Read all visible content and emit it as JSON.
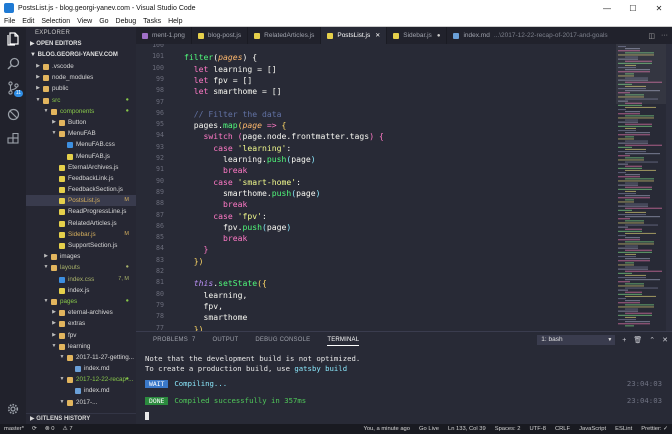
{
  "window": {
    "title": "PostsList.js - blog.georgi-yanev.com - Visual Studio Code",
    "buttons": {
      "minimize": "—",
      "maximize": "☐",
      "close": "✕"
    }
  },
  "menu": [
    "File",
    "Edit",
    "Selection",
    "View",
    "Go",
    "Debug",
    "Tasks",
    "Help"
  ],
  "activity_bar": {
    "scm_badge": "11",
    "icons": [
      "files-icon",
      "search-icon",
      "source-control-icon",
      "debug-icon",
      "extensions-icon",
      "settings-gear-icon"
    ]
  },
  "sidebar": {
    "header": "EXPLORER",
    "open_editors": "OPEN EDITORS",
    "project": "BLOG.GEORGI-YANEV.COM",
    "footer": "GITLENS HISTORY",
    "tree": [
      {
        "label": ".vscode",
        "depth": 0,
        "kind": "folder",
        "arrow": "▶"
      },
      {
        "label": "node_modules",
        "depth": 0,
        "kind": "folder",
        "arrow": "▶"
      },
      {
        "label": "public",
        "depth": 0,
        "kind": "folder",
        "arrow": "▶"
      },
      {
        "label": "src",
        "depth": 0,
        "kind": "folder",
        "arrow": "▼",
        "color": "green",
        "dot": true
      },
      {
        "label": "components",
        "depth": 1,
        "kind": "folder",
        "arrow": "▼",
        "color": "green",
        "dot": true
      },
      {
        "label": "Button",
        "depth": 2,
        "kind": "folder",
        "arrow": "▶"
      },
      {
        "label": "MenuFAB",
        "depth": 2,
        "kind": "folder",
        "arrow": "▼"
      },
      {
        "label": "MenuFAB.css",
        "depth": 3,
        "kind": "css"
      },
      {
        "label": "MenuFAB.js",
        "depth": 3,
        "kind": "js"
      },
      {
        "label": "EternalArchives.js",
        "depth": 2,
        "kind": "js"
      },
      {
        "label": "FeedbackLink.js",
        "depth": 2,
        "kind": "js"
      },
      {
        "label": "FeedbackSection.js",
        "depth": 2,
        "kind": "js"
      },
      {
        "label": "PostsList.js",
        "depth": 2,
        "kind": "js",
        "color": "gold",
        "decoration": "M",
        "selected": true
      },
      {
        "label": "ReadProgressLine.js",
        "depth": 2,
        "kind": "js"
      },
      {
        "label": "RelatedArticles.js",
        "depth": 2,
        "kind": "js"
      },
      {
        "label": "Sidebar.js",
        "depth": 2,
        "kind": "js",
        "color": "gold",
        "decoration": "M"
      },
      {
        "label": "SupportSection.js",
        "depth": 2,
        "kind": "js"
      },
      {
        "label": "images",
        "depth": 1,
        "kind": "folder",
        "arrow": "▶"
      },
      {
        "label": "layouts",
        "depth": 1,
        "kind": "folder",
        "arrow": "▼",
        "color": "olive",
        "dot": true
      },
      {
        "label": "index.css",
        "depth": 2,
        "kind": "css",
        "color": "olive",
        "decoration": "7, M"
      },
      {
        "label": "index.js",
        "depth": 2,
        "kind": "js"
      },
      {
        "label": "pages",
        "depth": 1,
        "kind": "folder",
        "arrow": "▼",
        "color": "green",
        "dot": true
      },
      {
        "label": "eternal-archives",
        "depth": 2,
        "kind": "folder",
        "arrow": "▶"
      },
      {
        "label": "extras",
        "depth": 2,
        "kind": "folder",
        "arrow": "▶"
      },
      {
        "label": "fpv",
        "depth": 2,
        "kind": "folder",
        "arrow": "▶"
      },
      {
        "label": "learning",
        "depth": 2,
        "kind": "folder",
        "arrow": "▼"
      },
      {
        "label": "2017-11-27-getting...",
        "depth": 3,
        "kind": "folder",
        "arrow": "▼"
      },
      {
        "label": "index.md",
        "depth": 4,
        "kind": "md"
      },
      {
        "label": "2017-12-22-recap-...",
        "depth": 3,
        "kind": "folder",
        "arrow": "▼",
        "color": "green",
        "dot": true
      },
      {
        "label": "index.md",
        "depth": 4,
        "kind": "md"
      },
      {
        "label": "2017-...",
        "depth": 3,
        "kind": "folder",
        "arrow": "▼"
      }
    ]
  },
  "tabs": [
    {
      "label": "ment-1.png",
      "icon": "image",
      "dot": false
    },
    {
      "label": "blog-post.js",
      "icon": "js",
      "dot": false
    },
    {
      "label": "RelatedArticles.js",
      "icon": "js",
      "dot": false
    },
    {
      "label": "PostsList.js",
      "icon": "js",
      "active": true,
      "close": "✕"
    },
    {
      "label": "Sidebar.js",
      "icon": "js",
      "dot": true
    },
    {
      "label": "index.md",
      "icon": "md",
      "dot": false,
      "suffix": "...\\2017-12-22-recap-of-2017-and-goals"
    }
  ],
  "editor": {
    "line_numbers": [
      "100",
      "101",
      "100",
      "99",
      "98",
      "97",
      "96",
      "95",
      "94",
      "93",
      "92",
      "91",
      "90",
      "89",
      "88",
      "87",
      "86",
      "85",
      "84",
      "83",
      "82",
      "81",
      "80",
      "79",
      "78",
      "77"
    ],
    "lines": [
      [
        {
          "t": "",
          "c": "pu"
        }
      ],
      [
        {
          "t": "filter",
          "c": "fn"
        },
        {
          "t": "(",
          "c": "pu"
        },
        {
          "t": "pages",
          "c": "par"
        },
        {
          "t": ") {",
          "c": "pu"
        }
      ],
      [
        {
          "t": "  let ",
          "c": "kw"
        },
        {
          "t": "learning",
          "c": "var"
        },
        {
          "t": " = []",
          "c": "pu"
        }
      ],
      [
        {
          "t": "  let ",
          "c": "kw"
        },
        {
          "t": "fpv",
          "c": "var"
        },
        {
          "t": " = []",
          "c": "pu"
        }
      ],
      [
        {
          "t": "  let ",
          "c": "kw"
        },
        {
          "t": "smarthome",
          "c": "var"
        },
        {
          "t": " = []",
          "c": "pu"
        }
      ],
      [
        {
          "t": "",
          "c": "pu"
        }
      ],
      [
        {
          "t": "  // Filter the data",
          "c": "cm"
        }
      ],
      [
        {
          "t": "  pages",
          "c": "var"
        },
        {
          "t": ".",
          "c": "pu"
        },
        {
          "t": "map",
          "c": "fn"
        },
        {
          "t": "(",
          "c": "b1"
        },
        {
          "t": "page",
          "c": "par"
        },
        {
          "t": " => ",
          "c": "kw"
        },
        {
          "t": "{",
          "c": "b1"
        }
      ],
      [
        {
          "t": "    switch ",
          "c": "kw"
        },
        {
          "t": "(",
          "c": "b2"
        },
        {
          "t": "page.node.frontmatter.tags",
          "c": "var"
        },
        {
          "t": ") ",
          "c": "b2"
        },
        {
          "t": "{",
          "c": "b2"
        }
      ],
      [
        {
          "t": "      case ",
          "c": "kw"
        },
        {
          "t": "'learning'",
          "c": "str"
        },
        {
          "t": ":",
          "c": "pu"
        }
      ],
      [
        {
          "t": "        learning",
          "c": "var"
        },
        {
          "t": ".",
          "c": "pu"
        },
        {
          "t": "push",
          "c": "fn"
        },
        {
          "t": "(",
          "c": "b3"
        },
        {
          "t": "page",
          "c": "var"
        },
        {
          "t": ")",
          "c": "b3"
        }
      ],
      [
        {
          "t": "        break",
          "c": "kw"
        }
      ],
      [
        {
          "t": "      case ",
          "c": "kw"
        },
        {
          "t": "'smart-home'",
          "c": "str"
        },
        {
          "t": ":",
          "c": "pu"
        }
      ],
      [
        {
          "t": "        smarthome",
          "c": "var"
        },
        {
          "t": ".",
          "c": "pu"
        },
        {
          "t": "push",
          "c": "fn"
        },
        {
          "t": "(",
          "c": "b3"
        },
        {
          "t": "page",
          "c": "var"
        },
        {
          "t": ")",
          "c": "b3"
        }
      ],
      [
        {
          "t": "        break",
          "c": "kw"
        }
      ],
      [
        {
          "t": "      case ",
          "c": "kw"
        },
        {
          "t": "'fpv'",
          "c": "str"
        },
        {
          "t": ":",
          "c": "pu"
        }
      ],
      [
        {
          "t": "        fpv",
          "c": "var"
        },
        {
          "t": ".",
          "c": "pu"
        },
        {
          "t": "push",
          "c": "fn"
        },
        {
          "t": "(",
          "c": "b3"
        },
        {
          "t": "page",
          "c": "var"
        },
        {
          "t": ")",
          "c": "b3"
        }
      ],
      [
        {
          "t": "        break",
          "c": "kw"
        }
      ],
      [
        {
          "t": "    }",
          "c": "b2"
        }
      ],
      [
        {
          "t": "  })",
          "c": "b1"
        }
      ],
      [
        {
          "t": "",
          "c": "pu"
        }
      ],
      [
        {
          "t": "  this",
          "c": "this"
        },
        {
          "t": ".",
          "c": "pu"
        },
        {
          "t": "setState",
          "c": "fn"
        },
        {
          "t": "({",
          "c": "b1"
        }
      ],
      [
        {
          "t": "    learning",
          "c": "var"
        },
        {
          "t": ",",
          "c": "pu"
        }
      ],
      [
        {
          "t": "    fpv",
          "c": "var"
        },
        {
          "t": ",",
          "c": "pu"
        }
      ],
      [
        {
          "t": "    smarthome",
          "c": "var"
        }
      ],
      [
        {
          "t": "  })",
          "c": "b1"
        }
      ]
    ]
  },
  "panel": {
    "tabs": [
      {
        "label": "PROBLEMS",
        "count": "7"
      },
      {
        "label": "OUTPUT"
      },
      {
        "label": "DEBUG CONSOLE"
      },
      {
        "label": "TERMINAL",
        "active": true
      }
    ],
    "terminal_select": "1: bash",
    "lines": {
      "l1": "Note that the development build is not optimized.",
      "l2_pre": "To create a production build, use ",
      "l2_cmd": "gatsby build",
      "wait_tag": "WAIT",
      "wait_text": "Compiling...",
      "wait_time": "23:04:03",
      "done_tag": "DONE",
      "done_text": "Compiled successfully in 357ms",
      "done_time": "23:04:03"
    }
  },
  "statusbar": {
    "branch": "master*",
    "sync": "⟳",
    "errors": "⊗ 0",
    "warnings": "⚠ 7",
    "blame": "You, a minute ago",
    "golive": "Go Live",
    "position": "Ln 133, Col 39",
    "spaces": "Spaces: 2",
    "encoding": "UTF-8",
    "eol": "CRLF",
    "language": "JavaScript",
    "eslint": "ESLint",
    "prettier": "Prettier: ✓"
  },
  "colors": {
    "folder": "#e2b55e",
    "js": "#e5d04b",
    "css": "#3d8fe0",
    "md": "#6aa0d8",
    "image": "#a070c8",
    "green": "#88c84a",
    "gold": "#d6b05e",
    "olive": "#a9b36a"
  }
}
